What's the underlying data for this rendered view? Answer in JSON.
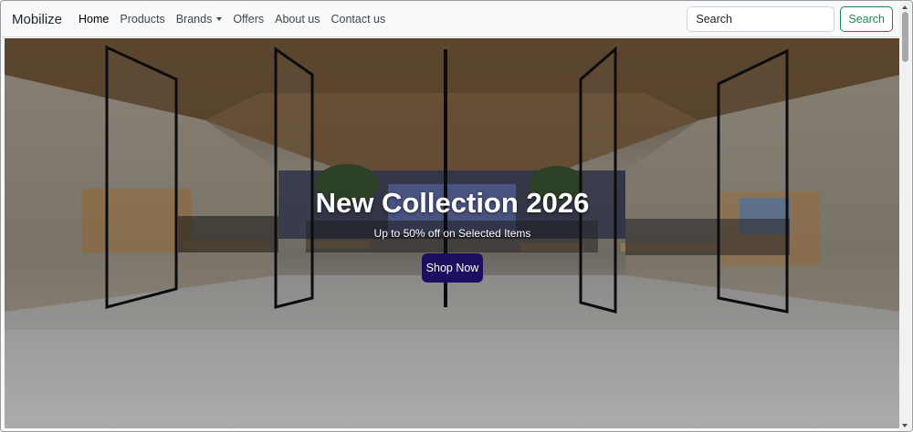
{
  "navbar": {
    "brand": "Mobilize",
    "links": [
      {
        "label": "Home",
        "active": true
      },
      {
        "label": "Products"
      },
      {
        "label": "Brands",
        "dropdown": true
      },
      {
        "label": "Offers"
      },
      {
        "label": "About us"
      },
      {
        "label": "Contact us"
      }
    ],
    "search": {
      "placeholder": "Search",
      "button_label": "Search"
    }
  },
  "hero": {
    "title": "New Collection 2026",
    "subtitle": "Up to 50% off on Selected Items",
    "cta_label": "Shop Now"
  },
  "colors": {
    "search_button": "#198754",
    "cta_background": "#1b1060",
    "navbar_background": "#f8f9fa"
  }
}
